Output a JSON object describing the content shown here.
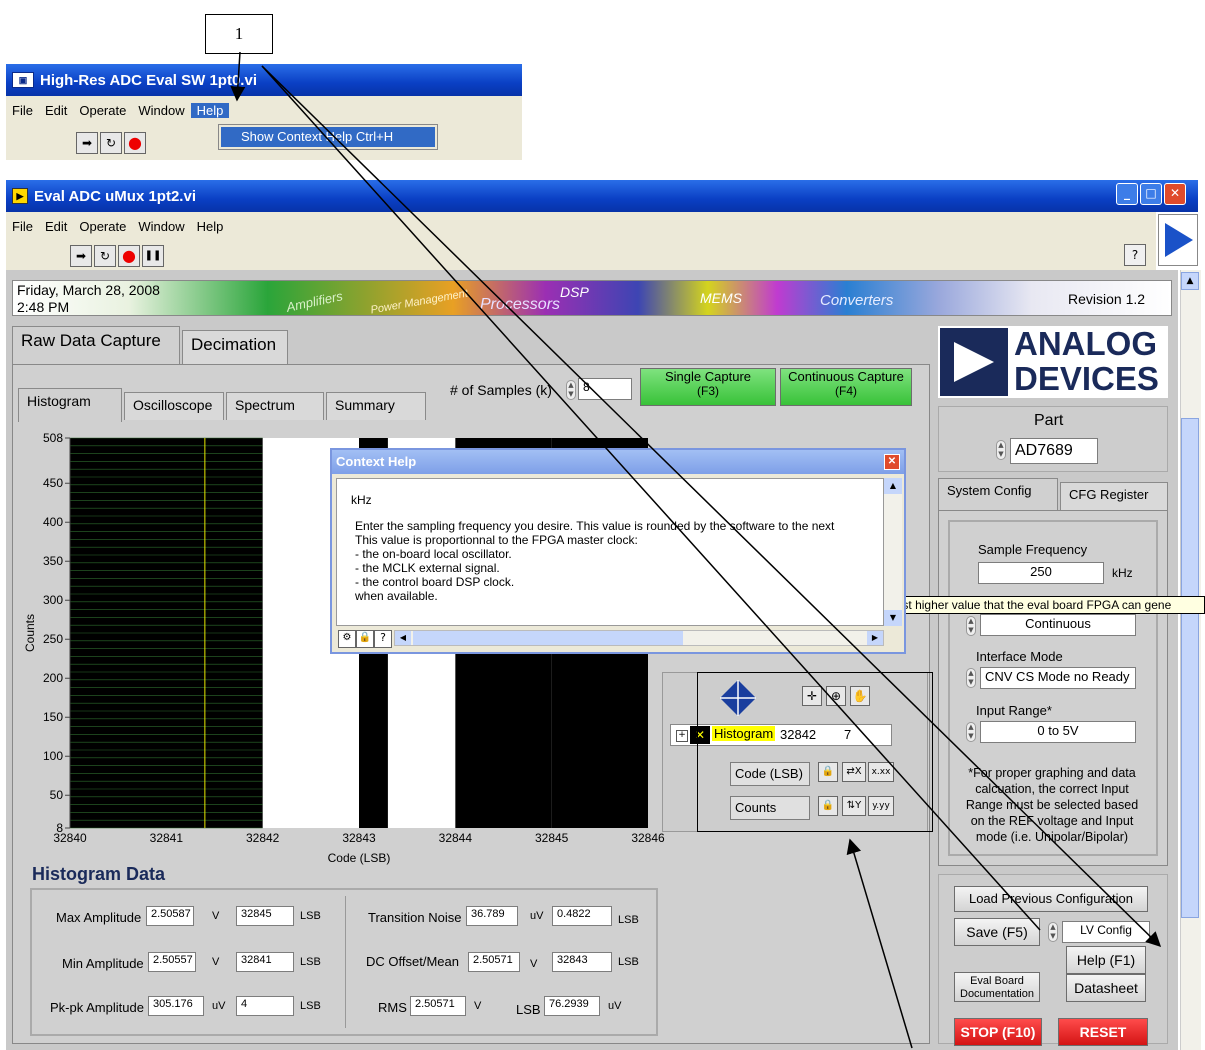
{
  "callout": {
    "number": "1"
  },
  "top_window": {
    "title": "High-Res ADC Eval SW 1pt0.vi",
    "menu": [
      "File",
      "Edit",
      "Operate",
      "Window",
      "Help"
    ],
    "help_menu_item": "Show Context Help",
    "help_menu_shortcut": "Ctrl+H"
  },
  "main_window": {
    "title": "Eval ADC uMux 1pt2.vi",
    "menu": [
      "File",
      "Edit",
      "Operate",
      "Window",
      "Help"
    ],
    "help_button": "?"
  },
  "banner": {
    "date": "Friday, March 28, 2008",
    "time": "2:48 PM",
    "revision": "Revision 1.2",
    "graphic_words": [
      "Amplifiers",
      "Power Management",
      "Processors",
      "DSP",
      "MEMS",
      "Converters"
    ]
  },
  "main_tabs": [
    "Raw Data Capture",
    "Decimation"
  ],
  "sub_tabs": [
    "Histogram",
    "Oscilloscope",
    "Spectrum",
    "Summary"
  ],
  "samples": {
    "label": "# of Samples (k)",
    "value": "8"
  },
  "capture_buttons": {
    "single": "Single Capture",
    "single_key": "(F3)",
    "continuous": "Continuous Capture",
    "continuous_key": "(F4)"
  },
  "brand": {
    "line1": "ANALOG",
    "line2": "DEVICES"
  },
  "part": {
    "label": "Part",
    "value": "AD7689"
  },
  "config_tabs": [
    "System Config",
    "CFG Register"
  ],
  "config": {
    "sample_freq_label": "Sample Frequency",
    "sample_freq_value": "250",
    "sample_freq_unit": "kHz",
    "mode_value": "Continuous",
    "interface_label": "Interface Mode",
    "interface_value": "CNV CS Mode no Ready",
    "range_label": "Input Range*",
    "range_value": "0 to 5V",
    "note": "*For proper graphing and data calcuation, the correct Input Range must be selected based on the REF voltage and Input mode (i.e. Unipolar/Bipolar)"
  },
  "tooltip": "Rounded to the closest higher value that the eval board FPGA can gene",
  "context_help": {
    "title": "Context Help",
    "unit": "kHz",
    "lines": [
      "Enter the sampling frequency you desire. This value is rounded by the software to the next",
      "This value is proportionnal to the FPGA master clock:",
      "- the on-board local oscillator.",
      "- the MCLK external signal.",
      "- the control board DSP clock.",
      "when available."
    ],
    "toolbar_help": "?"
  },
  "legend": {
    "plot_name": "Histogram",
    "x_readout": "32842",
    "y_readout": "7",
    "x_axis_name": "Code (LSB)",
    "y_axis_name": "Counts",
    "x_format": "x.xx",
    "y_format": "y.yy"
  },
  "bottom_buttons": {
    "load": "Load Previous Configuration",
    "save": "Save (F5)",
    "config_file": "LV Config",
    "help": "Help (F1)",
    "eval_doc_1": "Eval Board",
    "eval_doc_2": "Documentation",
    "datasheet": "Datasheet",
    "stop": "STOP (F10)",
    "reset": "RESET"
  },
  "histogram_data": {
    "title": "Histogram Data",
    "max_amp_label": "Max Amplitude",
    "max_amp_v": "2.50587",
    "max_amp_v_unit": "V",
    "max_amp_lsb": "32845",
    "max_amp_lsb_unit": "LSB",
    "min_amp_label": "Min Amplitude",
    "min_amp_v": "2.50557",
    "min_amp_v_unit": "V",
    "min_amp_lsb": "32841",
    "min_amp_lsb_unit": "LSB",
    "pkpk_label": "Pk-pk Amplitude",
    "pkpk_uv": "305.176",
    "pkpk_uv_unit": "uV",
    "pkpk_lsb": "4",
    "pkpk_lsb_unit": "LSB",
    "tn_label": "Transition Noise",
    "tn_uv": "36.789",
    "tn_uv_unit": "uV",
    "tn_lsb": "0.4822",
    "tn_lsb_unit": "LSB",
    "dc_label": "DC Offset/Mean",
    "dc_v": "2.50571",
    "dc_v_unit": "V",
    "dc_lsb": "32843",
    "dc_lsb_unit": "LSB",
    "rms_label": "RMS",
    "rms_v": "2.50571",
    "rms_v_unit": "V",
    "lsb_label": "LSB",
    "lsb_uv": "76.2939",
    "lsb_uv_unit": "uV"
  },
  "chart_data": {
    "type": "bar",
    "xlabel": "Code (LSB)",
    "ylabel": "Counts",
    "xlim": [
      32840,
      32846
    ],
    "ylim": [
      8,
      508
    ],
    "x_ticks": [
      "32840",
      "32841",
      "32842",
      "32843",
      "32844",
      "32845",
      "32846"
    ],
    "y_ticks": [
      "508",
      "450",
      "400",
      "350",
      "300",
      "250",
      "200",
      "150",
      "100",
      "50",
      "8"
    ],
    "bars": [
      {
        "x0": 32840,
        "x1": 32842,
        "y": 508
      },
      {
        "x0": 32843,
        "x1": 32843.3,
        "y": 508
      },
      {
        "x0": 32844,
        "x1": 32845,
        "y": 508
      },
      {
        "x0": 32845,
        "x1": 32846,
        "y": 508
      }
    ],
    "cursor_x": 32841.4,
    "bar_color": "#000000",
    "grid_color": "#2d6b2d",
    "cursor_color": "#e6e600"
  }
}
